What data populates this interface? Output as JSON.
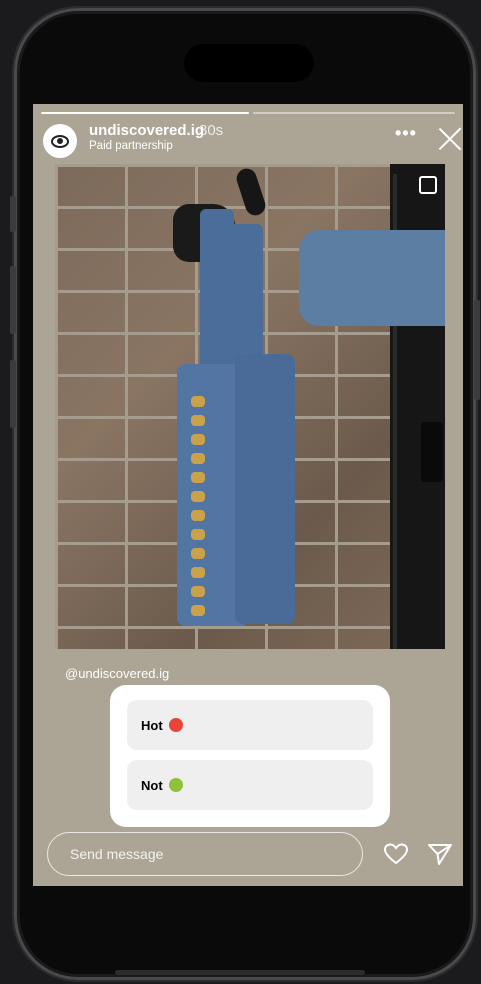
{
  "story": {
    "username": "undiscovered.ig",
    "time_ago": "30s",
    "subtitle": "Paid partnership",
    "mention": "@undiscovered.ig",
    "more_label": "•••",
    "progress_segments_done": 1,
    "progress_segments_total": 2
  },
  "poll": {
    "options": [
      {
        "label": "Hot",
        "emoji": "angry-face-icon"
      },
      {
        "label": "Not",
        "emoji": "nauseated-face-icon"
      }
    ]
  },
  "reply": {
    "placeholder": "Send message"
  },
  "icons": {
    "avatar": "eye-logo-icon",
    "more": "more-dots-icon",
    "close": "close-icon",
    "like": "heart-icon",
    "share": "send-icon",
    "carousel": "multiple-posts-icon"
  },
  "colors": {
    "story_background": "#aca596",
    "poll_background": "#ffffff",
    "option_background": "#efefef"
  }
}
